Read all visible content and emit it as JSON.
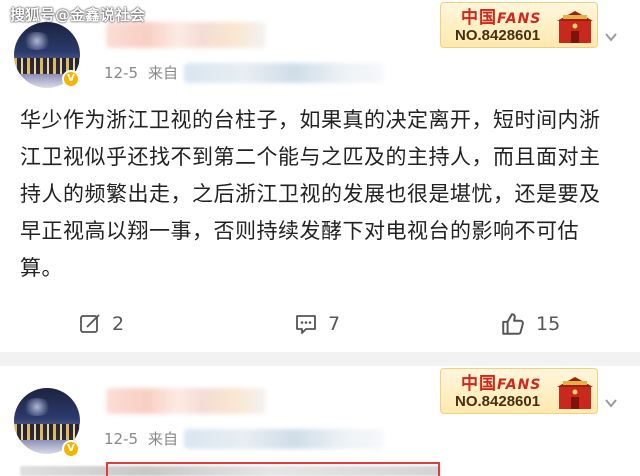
{
  "watermark": "搜狐号@金鑫说社会",
  "posts": [
    {
      "date": "12-5",
      "source_prefix": "来自",
      "badge": {
        "title": "中国",
        "title_suffix": "FANS",
        "number": "NO.8428601"
      },
      "content": "华少作为浙江卫视的台柱子，如果真的决定离开，短时间内浙江卫视似乎还找不到第二个能与之匹及的主持人，而且面对主持人的频繁出走，之后浙江卫视的发展也很是堪忧，还是要及早正视高以翔一事，否则持续发酵下对电视台的影响不可估算。",
      "actions": {
        "repost_count": "2",
        "comment_count": "7",
        "like_count": "15"
      }
    },
    {
      "date": "12-5",
      "source_prefix": "来自",
      "badge": {
        "title": "中国",
        "title_suffix": "FANS",
        "number": "NO.8428601"
      }
    }
  ],
  "colors": {
    "badge_red": "#d2261c",
    "verified": "#f5b400",
    "highlight_box": "#e23b3b"
  },
  "icons": [
    "chevron-down-icon",
    "repost-icon",
    "comment-icon",
    "like-icon",
    "verified-icon"
  ]
}
